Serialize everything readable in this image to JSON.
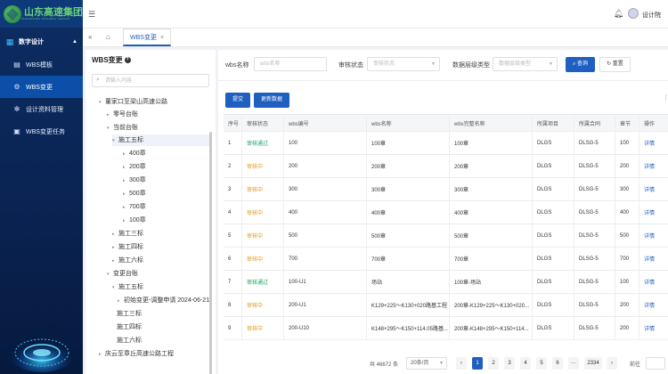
{
  "brand": {
    "name": "山东高速集团",
    "sub": "SHANDONG HIGHWAY GROUP"
  },
  "sidebar": {
    "group": {
      "label": "数字设计",
      "icon": "grid-icon"
    },
    "items": [
      {
        "label": "WBS模板",
        "icon": "book-icon",
        "active": false
      },
      {
        "label": "WBS变更",
        "icon": "hierarchy-icon",
        "active": true
      },
      {
        "label": "设计资料管理",
        "icon": "gear-icon",
        "active": false
      },
      {
        "label": "WBS变更任务",
        "icon": "task-icon",
        "active": false
      }
    ]
  },
  "topbar": {
    "user_name": "设计院"
  },
  "tabs": [
    {
      "label": "WBS变更"
    }
  ],
  "tree": {
    "title": "WBS变更",
    "search_placeholder": "请输入内容",
    "nodes": [
      "董家口至梁山高速公路",
      "零号台账",
      "当前台账",
      "施工五标",
      "400章",
      "200章",
      "300章",
      "500章",
      "700章",
      "100章",
      "施工三标",
      "施工四标",
      "施工六标",
      "变更台账",
      "施工五标",
      "初始变更-调整申请 2024-06-21",
      "施工三标",
      "施工四标",
      "施工六标",
      "庆云至章丘高速公路工程"
    ]
  },
  "filters": {
    "wbs_name_label": "wbs名称",
    "wbs_name_placeholder": "wbs名称",
    "status_label": "审核状态",
    "status_placeholder": "审核状态",
    "type_label": "数据层级类型",
    "type_placeholder": "数据层级类型",
    "search_btn": "查询",
    "reset_btn": "重置"
  },
  "actions": {
    "submit": "提交",
    "update": "更新数据"
  },
  "table": {
    "headers": [
      "序号",
      "审核状态",
      "wbs编号",
      "wbs名称",
      "wbs完整名称",
      "所属项目",
      "所属合同",
      "章节",
      "操作"
    ],
    "rows": [
      [
        "1",
        "审核通过",
        "100",
        "100章",
        "100章",
        "DLGS",
        "DLSG-5",
        "100",
        "详情"
      ],
      [
        "2",
        "审核中",
        "200",
        "200章",
        "200章",
        "DLGS",
        "DLSG-5",
        "200",
        "详情"
      ],
      [
        "3",
        "审核中",
        "300",
        "300章",
        "300章",
        "DLGS",
        "DLSG-5",
        "300",
        "详情"
      ],
      [
        "4",
        "审核中",
        "400",
        "400章",
        "400章",
        "DLGS",
        "DLSG-5",
        "400",
        "详情"
      ],
      [
        "5",
        "审核中",
        "500",
        "500章",
        "500章",
        "DLGS",
        "DLSG-5",
        "500",
        "详情"
      ],
      [
        "6",
        "审核中",
        "700",
        "700章",
        "700章",
        "DLGS",
        "DLSG-5",
        "700",
        "详情"
      ],
      [
        "7",
        "审核通过",
        "100-U1",
        "场站",
        "100章-场站",
        "DLGS",
        "DLSG-5",
        "100",
        "详情"
      ],
      [
        "8",
        "审核中",
        "200-U1",
        "K129+225～K130+020路基工程",
        "200章-K129+225～K130+020...",
        "DLGS",
        "DLSG-5",
        "200",
        "详情"
      ],
      [
        "9",
        "审核中",
        "200-U10",
        "K148+295～K150+114.05路基...",
        "200章-K148+295～K150+114...",
        "DLGS",
        "DLSG-5",
        "200",
        "详情"
      ]
    ]
  },
  "pagination": {
    "total": "共 46672 条",
    "page_size": "20条/页",
    "pages": [
      "1",
      "2",
      "3",
      "4",
      "5",
      "6",
      "···",
      "2334"
    ],
    "current": "1",
    "goto_label": "前往"
  }
}
